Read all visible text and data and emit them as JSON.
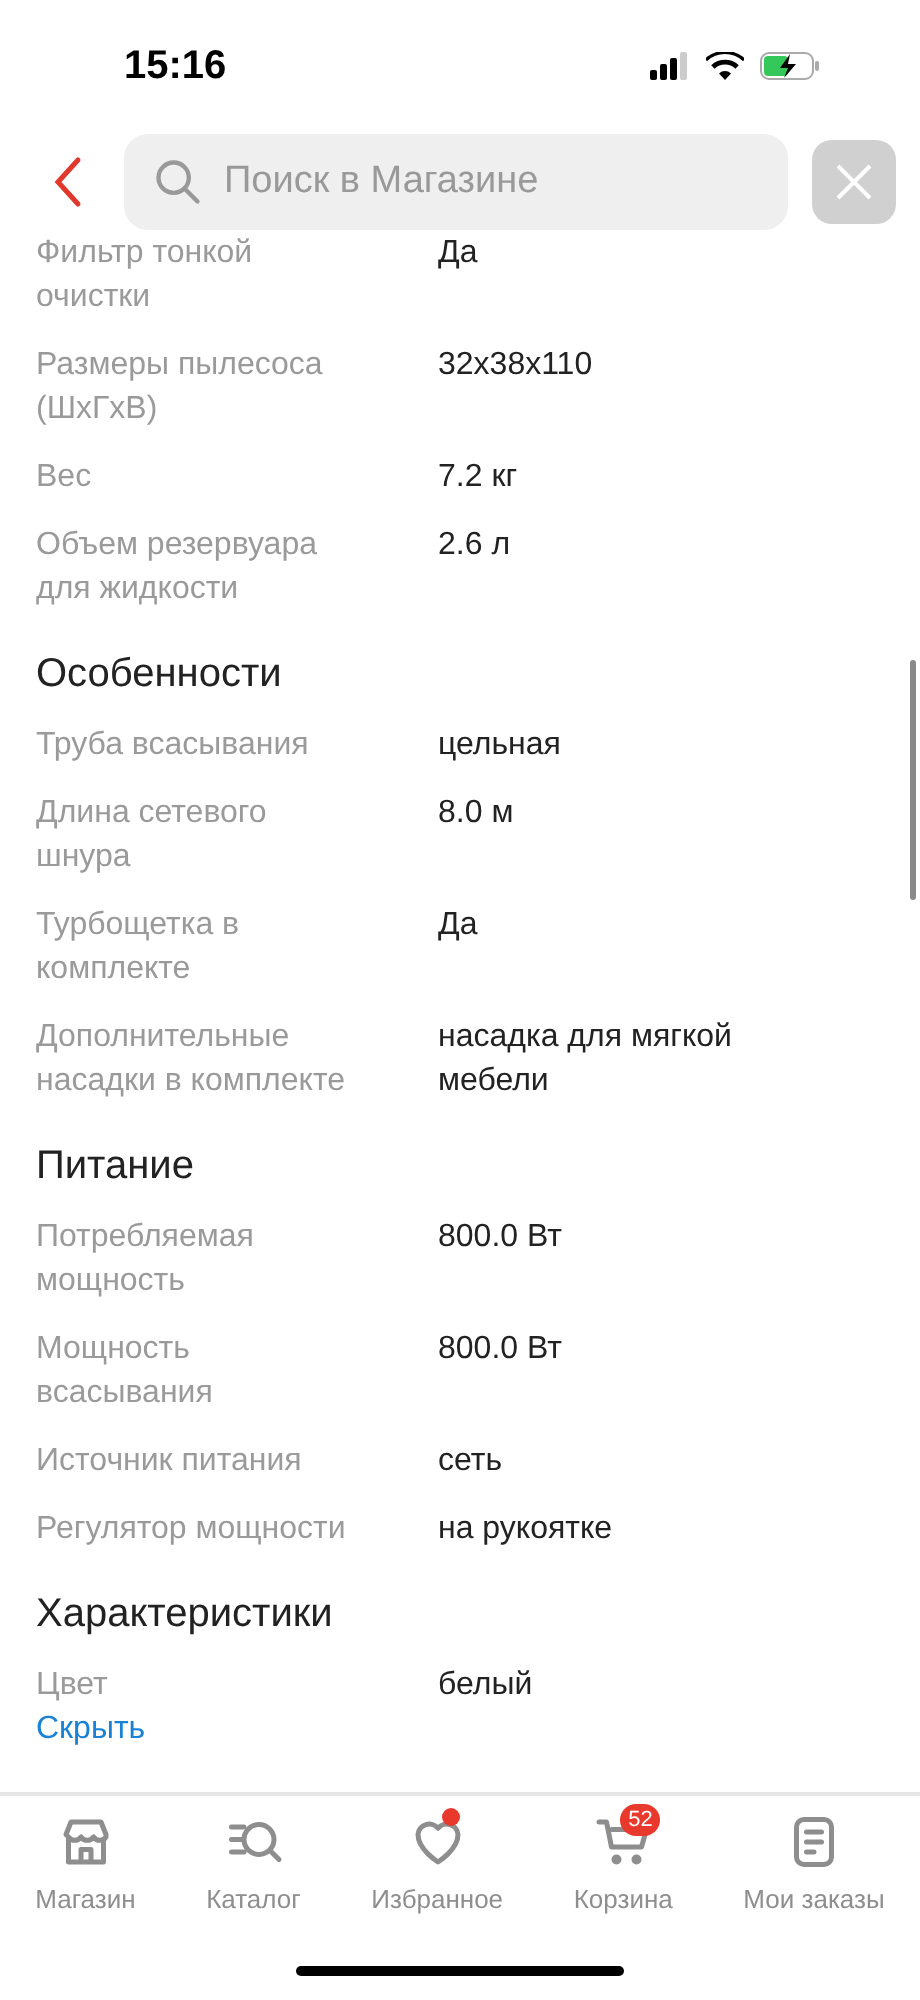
{
  "status_bar": {
    "time": "15:16"
  },
  "search": {
    "placeholder": "Поиск в Магазине"
  },
  "specs": [
    {
      "kind": "row",
      "label": "Фильтр тонкой очистки",
      "value": "Да"
    },
    {
      "kind": "row",
      "label": "Размеры пылесоса (ШхГхВ)",
      "value": "32x38x110"
    },
    {
      "kind": "row",
      "label": "Вес",
      "value": "7.2 кг"
    },
    {
      "kind": "row",
      "label": "Объем резервуара для жидкости",
      "value": "2.6 л"
    },
    {
      "kind": "section",
      "label": "Особенности"
    },
    {
      "kind": "row",
      "label": "Труба всасывания",
      "value": "цельная"
    },
    {
      "kind": "row",
      "label": "Длина сетевого шнура",
      "value": "8.0 м"
    },
    {
      "kind": "row",
      "label": "Турбощетка в комплекте",
      "value": "Да"
    },
    {
      "kind": "row",
      "label": "Дополнительные насадки в комплекте",
      "value": "насадка для мягкой мебели"
    },
    {
      "kind": "section",
      "label": "Питание"
    },
    {
      "kind": "row",
      "label": "Потребляемая мощность",
      "value": "800.0 Вт"
    },
    {
      "kind": "row",
      "label": "Мощность всасывания",
      "value": "800.0 Вт"
    },
    {
      "kind": "row",
      "label": "Источник питания",
      "value": "сеть"
    },
    {
      "kind": "row",
      "label": "Регулятор мощности",
      "value": "на рукоятке"
    },
    {
      "kind": "section",
      "label": "Характеристики"
    },
    {
      "kind": "row",
      "label": "Цвет",
      "value": "белый"
    }
  ],
  "hide_link": "Скрыть",
  "tabs": [
    {
      "kind": "shop",
      "label": "Магазин"
    },
    {
      "kind": "catalog",
      "label": "Каталог"
    },
    {
      "kind": "favorites",
      "label": "Избранное",
      "dot": true
    },
    {
      "kind": "cart",
      "label": "Корзина",
      "badge": "52"
    },
    {
      "kind": "orders",
      "label": "Мои заказы"
    }
  ]
}
